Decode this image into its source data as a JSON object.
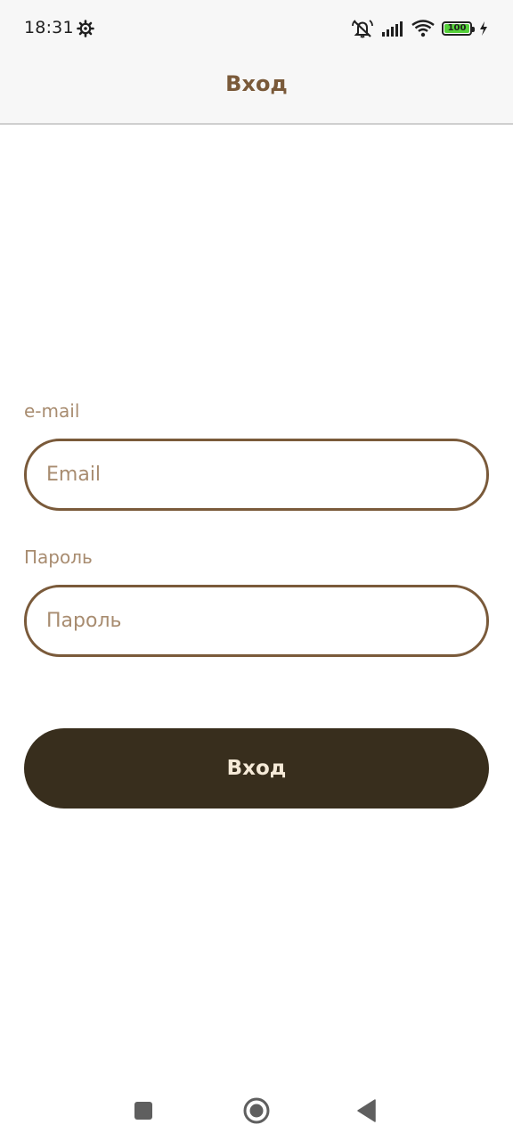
{
  "status_bar": {
    "time": "18:31",
    "battery_level": "100",
    "icons": [
      "settings-icon",
      "mute-icon",
      "signal-icon",
      "wifi-icon",
      "battery-icon",
      "charging-icon"
    ],
    "battery_color": "#55d13a"
  },
  "app_bar": {
    "title": "Вход"
  },
  "form": {
    "email_label": "e-mail",
    "email_placeholder": "Email",
    "email_value": "",
    "password_label": "Пароль",
    "password_placeholder": "Пароль",
    "password_value": "",
    "submit_label": "Вход"
  },
  "nav_bar": {
    "icons": [
      "recents-square-icon",
      "home-circle-icon",
      "back-triangle-icon"
    ]
  },
  "colors": {
    "accent": "#7a5a3a",
    "label": "#a88c70",
    "button_bg": "#382e1d",
    "button_text": "#f5ead8"
  }
}
